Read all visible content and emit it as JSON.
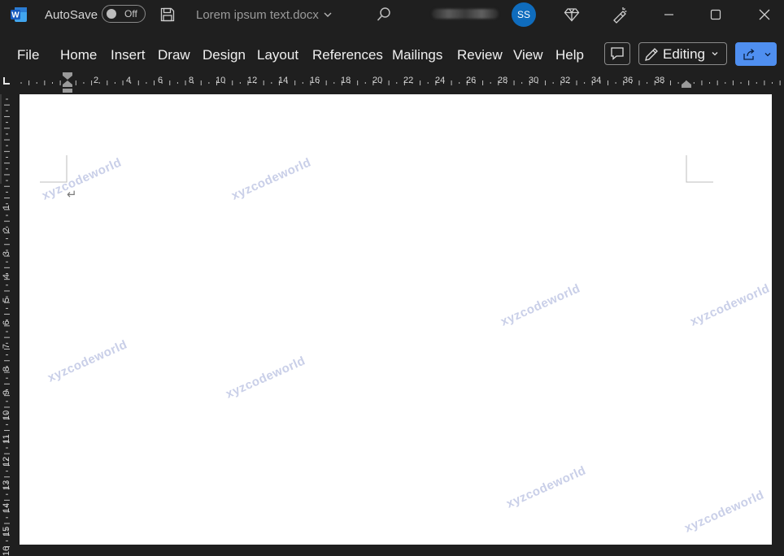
{
  "titlebar": {
    "app_logo_letter": "W",
    "autosave_label": "AutoSave",
    "autosave_state": "Off",
    "document_title": "Lorem ipsum text.docx",
    "avatar_initials": "SS"
  },
  "ribbon": {
    "tabs": [
      "File",
      "Home",
      "Insert",
      "Draw",
      "Design",
      "Layout",
      "References",
      "Mailings",
      "Review",
      "View",
      "Help"
    ],
    "editing_label": "Editing"
  },
  "rulers": {
    "horizontal_labels": [
      "2",
      "4",
      "6",
      "8",
      "10",
      "12",
      "14",
      "16",
      "18",
      "20",
      "22",
      "24",
      "26",
      "28",
      "30",
      "32",
      "34",
      "36",
      "38"
    ],
    "vertical_labels": [
      "1",
      "2",
      "3",
      "4",
      "5",
      "6",
      "7",
      "8",
      "9",
      "10",
      "11",
      "12",
      "13",
      "14",
      "15",
      "16"
    ]
  },
  "page": {
    "paragraph_mark": "↵",
    "watermark_text": "xyzcodeworld"
  },
  "colors": {
    "accent": "#4f8ff0",
    "avatar": "#0f6cbd",
    "background": "#1f1f1f"
  }
}
